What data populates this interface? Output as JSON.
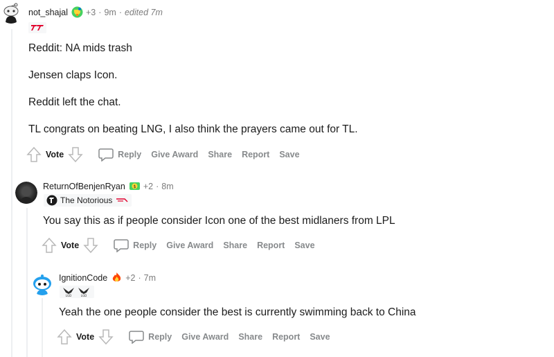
{
  "comments": [
    {
      "username": "not_shajal",
      "score": "+3",
      "age": "9m",
      "edited": "edited 7m",
      "award_icon": "trophy-icon",
      "flair_text": "",
      "flair_icon": "t1-logo-icon",
      "paragraphs": [
        "Reddit: NA mids trash",
        "Jensen claps Icon.",
        "Reddit left the chat.",
        "TL congrats on beating LNG, I also think the prayers came out for TL."
      ],
      "actions": {
        "vote": "Vote",
        "reply": "Reply",
        "give_award": "Give Award",
        "share": "Share",
        "report": "Report",
        "save": "Save"
      }
    },
    {
      "username": "ReturnOfBenjenRyan",
      "score": "+2",
      "age": "8m",
      "award_icon": "money-face-icon",
      "flair_text": "The Notorious",
      "flair_icon": "tundra-logo-icon",
      "paragraphs": [
        "You say this as if people consider Icon one of the best midlaners from LPL"
      ],
      "actions": {
        "vote": "Vote",
        "reply": "Reply",
        "give_award": "Give Award",
        "share": "Share",
        "report": "Report",
        "save": "Save"
      }
    },
    {
      "username": "IgnitionCode",
      "score": "+2",
      "age": "7m",
      "award_icon": "fire-award-icon",
      "flair_text": "",
      "flair_icon": "lgd-logo-icon",
      "paragraphs": [
        "Yeah the one people consider the best is currently swimming back to China"
      ],
      "actions": {
        "vote": "Vote",
        "reply": "Reply",
        "give_award": "Give Award",
        "share": "Share",
        "report": "Report",
        "save": "Save"
      }
    }
  ],
  "colors": {
    "meta": "#7c7c7c",
    "action": "#878a8c",
    "thread_line": "#edeff1",
    "text": "#1c1c1c"
  }
}
